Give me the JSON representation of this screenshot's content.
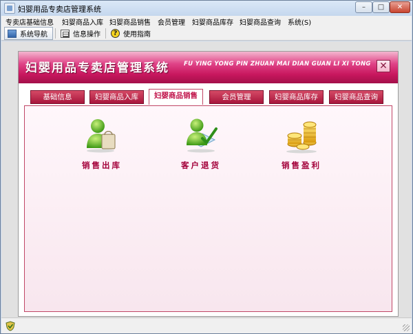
{
  "window": {
    "title": "妇婴用品专卖店管理系统",
    "controls": {
      "minimize": "–",
      "maximize": "□",
      "close": "✕"
    }
  },
  "menu": {
    "items": [
      {
        "label": "专卖店基础信息"
      },
      {
        "label": "妇婴商品入库"
      },
      {
        "label": "妇婴商品销售"
      },
      {
        "label": "会员管理"
      },
      {
        "label": "妇婴商品库存"
      },
      {
        "label": "妇婴商品查询"
      },
      {
        "label": "系统(S)"
      }
    ]
  },
  "toolbar": {
    "items": [
      {
        "label": "系统导航",
        "icon": "monitor-icon",
        "active": true
      },
      {
        "label": "信息操作",
        "icon": "grid-icon",
        "active": false
      },
      {
        "label": "使用指南",
        "icon": "help-icon",
        "active": false
      }
    ]
  },
  "banner": {
    "title": "妇婴用品专卖店管理系统",
    "subtitle": "FU YING YONG PIN ZHUAN MAI DIAN GUAN LI XI TONG",
    "close": "✕"
  },
  "tabs": [
    {
      "label": "基础信息",
      "active": false
    },
    {
      "label": "妇婴商品入库",
      "active": false
    },
    {
      "label": "妇婴商品销售",
      "active": true
    },
    {
      "label": "会员管理",
      "active": false
    },
    {
      "label": "妇婴商品库存",
      "active": false
    },
    {
      "label": "妇婴商品查询",
      "active": false
    }
  ],
  "functions": [
    {
      "label": "销售出库",
      "icon": "user-shopping-bag-icon"
    },
    {
      "label": "客户退货",
      "icon": "user-return-icon"
    },
    {
      "label": "销售盈利",
      "icon": "gold-coins-icon"
    }
  ],
  "colors": {
    "brand": "#c8175e",
    "tab_bg": "#a8163c",
    "label": "#a3003a"
  }
}
